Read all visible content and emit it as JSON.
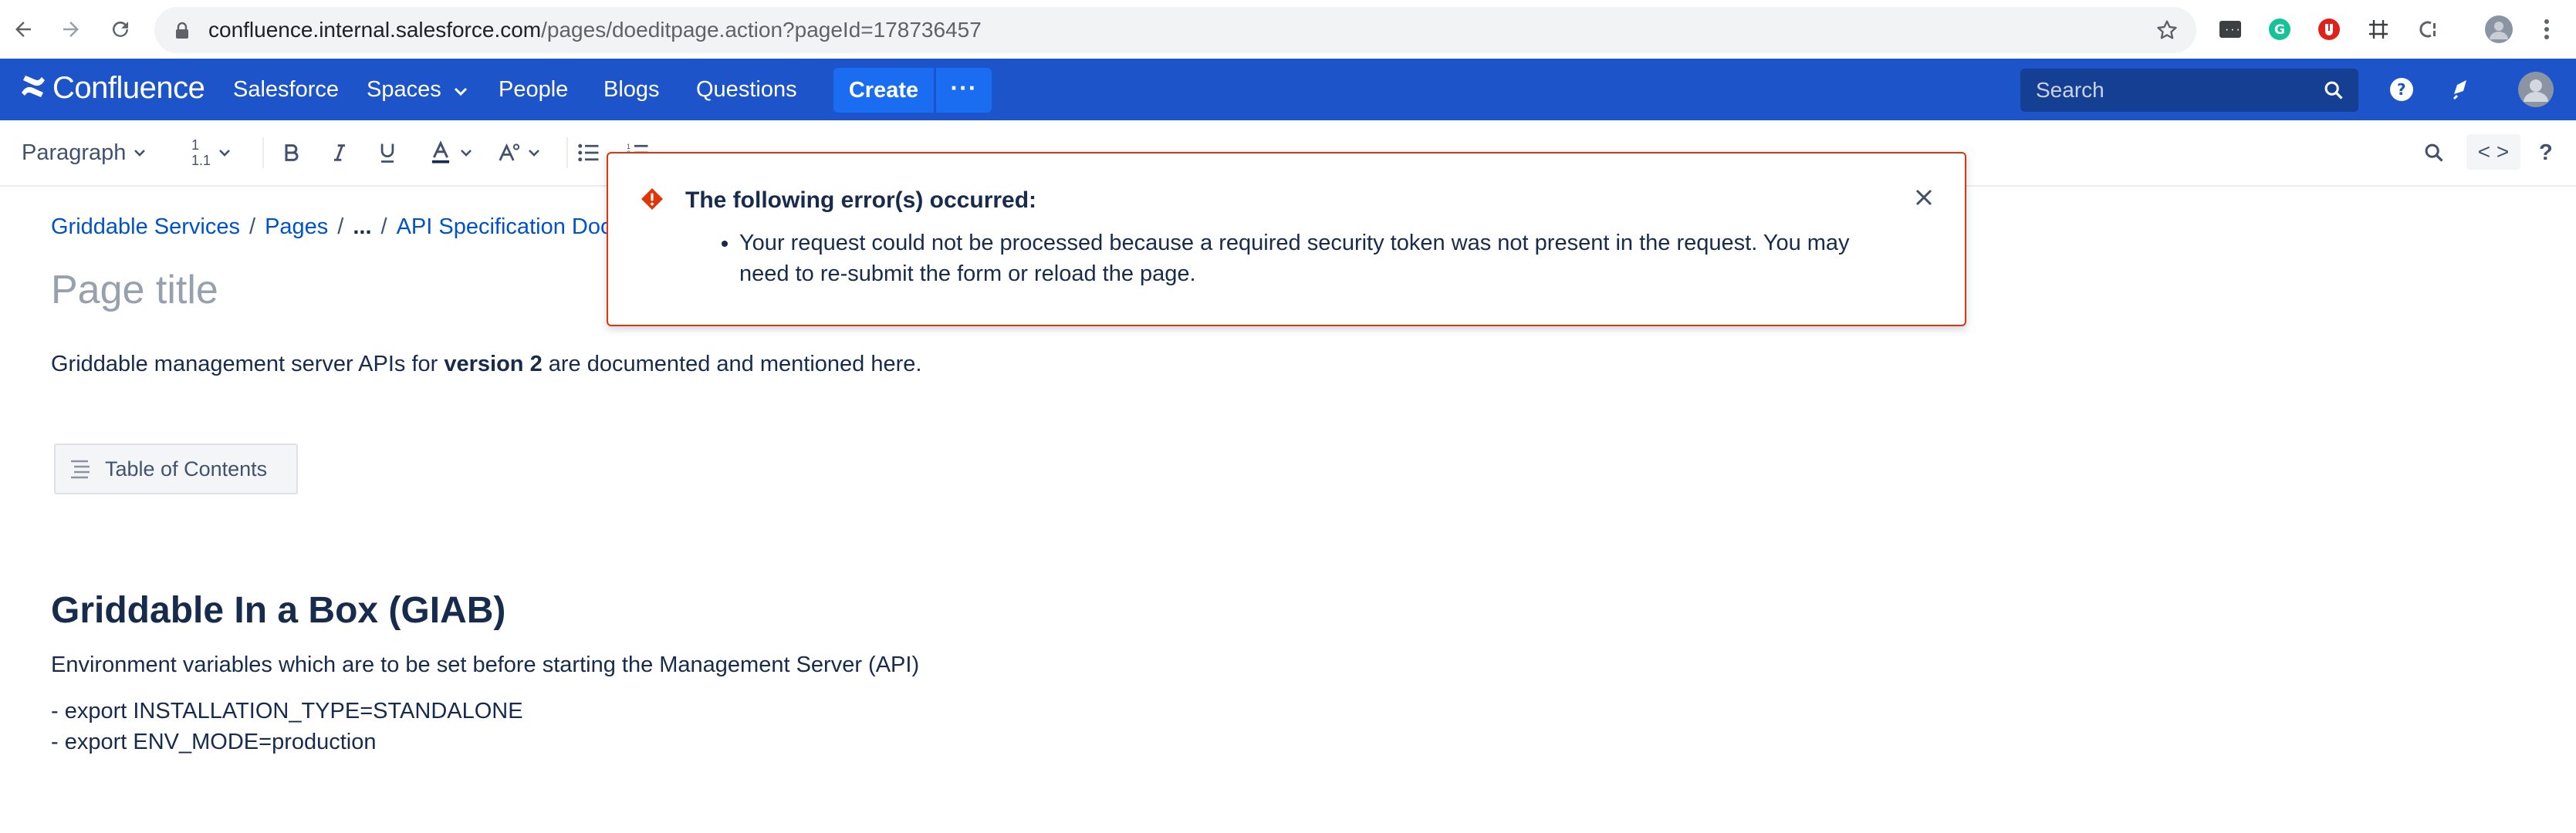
{
  "browser": {
    "url_host": "confluence.internal.salesforce.com",
    "url_path": "/pages/doeditpage.action?pageId=178736457",
    "icons": [
      "back-arrow-icon",
      "forward-arrow-icon",
      "reload-icon",
      "lock-icon",
      "bookmark-star-icon",
      "terminal-extension-icon",
      "grammarly-extension-icon",
      "shield-extension-icon",
      "grid-extension-icon",
      "c-extension-icon",
      "profile-avatar-icon"
    ]
  },
  "header": {
    "logo_text": "Confluence",
    "nav": {
      "salesforce": "Salesforce",
      "spaces": "Spaces",
      "people": "People",
      "blogs": "Blogs",
      "questions": "Questions"
    },
    "create_label": "Create",
    "more_label": "···",
    "search_placeholder": "Search",
    "brand_color": "#1d54c9"
  },
  "toolbar": {
    "paragraph_label": "Paragraph",
    "source_label": "< >",
    "help_label": "?",
    "heading_num_top": "1",
    "heading_num_bottom": "1.1"
  },
  "breadcrumb": {
    "items": [
      "Griddable Services",
      "Pages",
      "...",
      "API Specification Doc"
    ],
    "separator": "/"
  },
  "page": {
    "title_placeholder": "Page title",
    "intro_before": "Griddable management server APIs for ",
    "intro_bold": "version 2",
    "intro_after": " are documented and mentioned here.",
    "toc_label": "Table of Contents",
    "heading": "Griddable In a Box (GIAB)",
    "env_text": "Environment variables which are to be set before starting the Management Server (API)",
    "export_1": "- export INSTALLATION_TYPE=STANDALONE",
    "export_2": "- export ENV_MODE=production"
  },
  "error": {
    "title": "The following error(s) occurred:",
    "message": "Your request could not be processed because a required security token was not present in the request. You may need to re-submit the form or reload the page.",
    "accent_color": "#de350b"
  }
}
